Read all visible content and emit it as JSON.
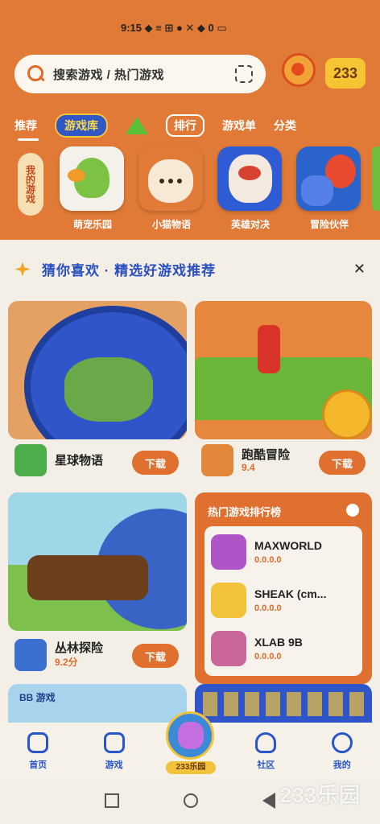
{
  "status_bar": {
    "text": "9:15 ◆ ≡ ⊞  ● ✕ ◆ 0 ▭"
  },
  "search": {
    "placeholder": "搜索游戏 / 热门游戏"
  },
  "header": {
    "badge_label": "233"
  },
  "tabs": {
    "items": [
      "推荐",
      "游戏库",
      "排行",
      "游戏单",
      "分类"
    ],
    "active_index": 1
  },
  "side_pill": {
    "label": "我的游戏"
  },
  "apps": [
    {
      "name": "萌宠乐园"
    },
    {
      "name": "小猫物语"
    },
    {
      "name": "英雄对决"
    },
    {
      "name": "冒险伙伴"
    }
  ],
  "section": {
    "title": "猜你喜欢 · 精选好游戏推荐"
  },
  "cards": [
    {
      "game_name": "星球物语",
      "button": "下载"
    },
    {
      "game_name": "跑酷冒险",
      "sub": "9.4",
      "button": "下载"
    },
    {
      "game_name": "丛林探险",
      "sub": "9.2分",
      "button": "下载"
    }
  ],
  "list_card": {
    "title": "热门游戏排行榜",
    "items": [
      {
        "name": "MAXWORLD",
        "sub": "0.0.0.0"
      },
      {
        "name": "SHEAK (cm...",
        "sub": "0.0.0.0"
      },
      {
        "name": "XLAB 9B",
        "sub": "0.0.0.0"
      }
    ]
  },
  "peek": {
    "left_label": "BB 游戏"
  },
  "nav": {
    "items": [
      "首页",
      "游戏",
      "",
      "社区",
      "我的"
    ],
    "center_label": "233乐园"
  },
  "watermark": "233乐园"
}
